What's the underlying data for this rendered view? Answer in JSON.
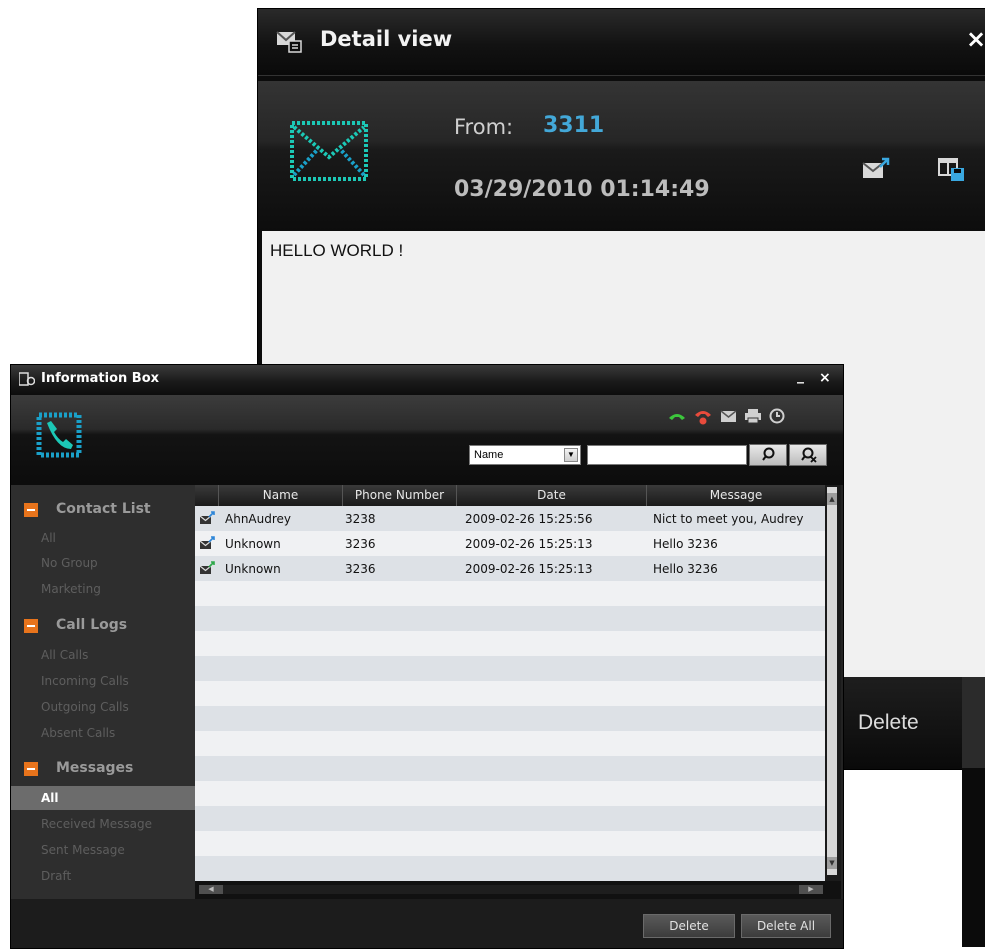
{
  "detail_view": {
    "title": "Detail view",
    "close_glyph": "×",
    "from_label": "From:",
    "from_value": "3311",
    "datetime": "03/29/2010 01:14:49",
    "body": "HELLO WORLD !",
    "delete_label": "Delete",
    "icons": [
      "message-icon",
      "envelope-icon",
      "reply-icon",
      "save-icon",
      "close-icon"
    ],
    "colors": {
      "from_value": "#43a8d8",
      "envelope": "#1cc8b6"
    }
  },
  "info_box": {
    "title": "Information Box",
    "minimize_glyph": "_",
    "close_glyph": "×",
    "toolbar_icons": [
      "call-icon",
      "hangup-icon",
      "message-icon",
      "print-icon",
      "settings-icon"
    ],
    "search": {
      "field_selected": "Name",
      "query": "",
      "search_icon": "search-icon",
      "advanced_icon": "advanced-search-icon"
    },
    "sidebar": {
      "sections": [
        {
          "label": "Contact List",
          "items": [
            {
              "label": "All"
            },
            {
              "label": "No Group"
            },
            {
              "label": "Marketing"
            }
          ]
        },
        {
          "label": "Call Logs",
          "items": [
            {
              "label": "All Calls"
            },
            {
              "label": "Incoming Calls"
            },
            {
              "label": "Outgoing Calls"
            },
            {
              "label": "Absent Calls"
            }
          ]
        },
        {
          "label": "Messages",
          "items": [
            {
              "label": "All"
            },
            {
              "label": "Received Message"
            },
            {
              "label": "Sent Message"
            },
            {
              "label": "Draft"
            }
          ]
        }
      ],
      "active": "Messages/All"
    },
    "table": {
      "columns": [
        "Name",
        "Phone Number",
        "Date",
        "Message"
      ],
      "rows": [
        {
          "name": "AhnAudrey",
          "phone": "3238",
          "date": "2009-02-26 15:25:56",
          "message": "Nict to meet you, Audrey"
        },
        {
          "name": "Unknown",
          "phone": "3236",
          "date": "2009-02-26 15:25:13",
          "message": "Hello 3236"
        },
        {
          "name": "Unknown",
          "phone": "3236",
          "date": "2009-02-26 15:25:13",
          "message": "Hello 3236"
        }
      ]
    },
    "footer": {
      "delete_label": "Delete",
      "delete_all_label": "Delete All"
    }
  }
}
